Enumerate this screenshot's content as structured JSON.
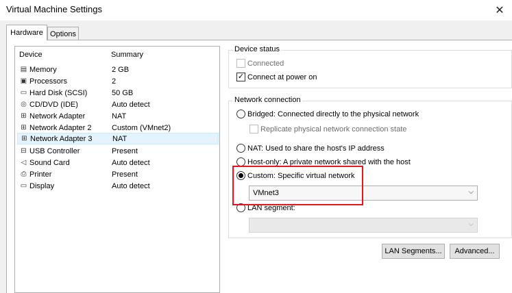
{
  "window": {
    "title": "Virtual Machine Settings",
    "close_glyph": "✕"
  },
  "tabs": [
    {
      "label": "Hardware",
      "active": true
    },
    {
      "label": "Options",
      "active": false
    }
  ],
  "device_list": {
    "headers": {
      "device": "Device",
      "summary": "Summary"
    },
    "rows": [
      {
        "icon": "memory-icon",
        "glyph": "▤",
        "name": "Memory",
        "summary": "2 GB"
      },
      {
        "icon": "processor-icon",
        "glyph": "▣",
        "name": "Processors",
        "summary": "2"
      },
      {
        "icon": "hard-disk-icon",
        "glyph": "▭",
        "name": "Hard Disk (SCSI)",
        "summary": "50 GB"
      },
      {
        "icon": "cd-dvd-icon",
        "glyph": "◎",
        "name": "CD/DVD (IDE)",
        "summary": "Auto detect"
      },
      {
        "icon": "network-adapter-icon",
        "glyph": "⊞",
        "name": "Network Adapter",
        "summary": "NAT"
      },
      {
        "icon": "network-adapter-icon",
        "glyph": "⊞",
        "name": "Network Adapter 2",
        "summary": "Custom (VMnet2)"
      },
      {
        "icon": "network-adapter-icon",
        "glyph": "⊞",
        "name": "Network Adapter 3",
        "summary": "NAT",
        "selected": true
      },
      {
        "icon": "usb-controller-icon",
        "glyph": "⊟",
        "name": "USB Controller",
        "summary": "Present"
      },
      {
        "icon": "sound-card-icon",
        "glyph": "◁",
        "name": "Sound Card",
        "summary": "Auto detect"
      },
      {
        "icon": "printer-icon",
        "glyph": "⎙",
        "name": "Printer",
        "summary": "Present"
      },
      {
        "icon": "display-icon",
        "glyph": "▭",
        "name": "Display",
        "summary": "Auto detect"
      }
    ]
  },
  "device_status": {
    "label": "Device status",
    "connected": {
      "label": "Connected",
      "checked": false,
      "disabled": true
    },
    "connect_at_power_on": {
      "label": "Connect at power on",
      "checked": true,
      "check_glyph": "✓"
    }
  },
  "network_connection": {
    "label": "Network connection",
    "bridged": {
      "label": "Bridged: Connected directly to the physical network",
      "checked": false
    },
    "replicate": {
      "label": "Replicate physical network connection state",
      "checked": false,
      "disabled": true
    },
    "nat": {
      "label": "NAT: Used to share the host's IP address",
      "checked": false
    },
    "host_only": {
      "label": "Host-only: A private network shared with the host",
      "checked": false
    },
    "custom": {
      "label": "Custom: Specific virtual network",
      "checked": true
    },
    "custom_network_value": "VMnet3",
    "lan_segment": {
      "label": "LAN segment:",
      "checked": false
    },
    "lan_segment_value": "",
    "chevron_glyph": "⌵"
  },
  "buttons": {
    "lan_segments": "LAN Segments...",
    "advanced": "Advanced..."
  },
  "colors": {
    "highlight": "#e8141e",
    "selection": "#e5f3ff"
  }
}
